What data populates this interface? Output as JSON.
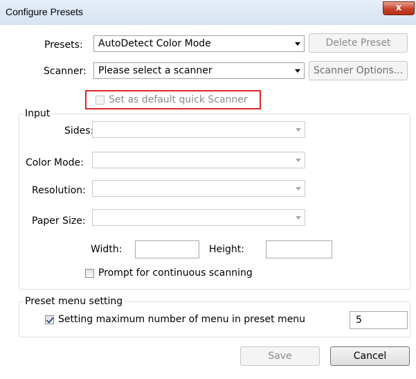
{
  "window": {
    "title": "Configure Presets",
    "close_label": "x"
  },
  "presets": {
    "label": "Presets:",
    "value": "AutoDetect Color Mode",
    "delete_label": "Delete Preset"
  },
  "scanner": {
    "label": "Scanner:",
    "value": "Please select a scanner",
    "options_label": "Scanner Options..."
  },
  "default_quick": {
    "label": "Set as default quick Scanner",
    "checked": false,
    "enabled": false
  },
  "input_group": {
    "title": "Input",
    "sides_label": "Sides:",
    "color_mode_label": "Color Mode:",
    "resolution_label": "Resolution:",
    "paper_size_label": "Paper Size:",
    "width_label": "Width:",
    "height_label": "Height:",
    "width_value": "",
    "height_value": "",
    "prompt_label": "Prompt for continuous scanning",
    "prompt_checked": false
  },
  "preset_menu": {
    "title": "Preset menu setting",
    "max_label": "Setting maximum number of menu in preset menu",
    "max_checked": true,
    "max_value": "5"
  },
  "footer": {
    "save_label": "Save",
    "cancel_label": "Cancel"
  },
  "colors": {
    "highlight": "#e0252a",
    "titlebar": "#dce7f5",
    "close": "#c5432b"
  }
}
